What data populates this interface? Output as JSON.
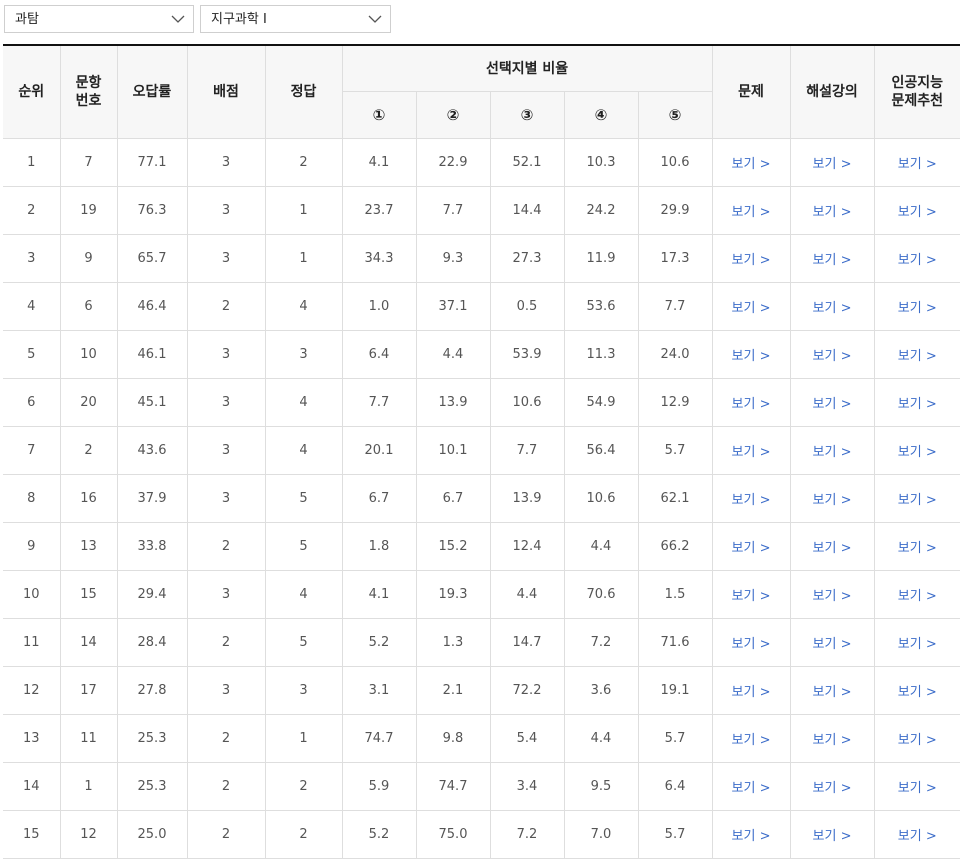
{
  "filters": {
    "category": "과탐",
    "subject": "지구과학 I"
  },
  "table": {
    "headers": {
      "rank": "순위",
      "question_no_line1": "문항",
      "question_no_line2": "번호",
      "error_rate": "오답률",
      "points": "배점",
      "answer": "정답",
      "choice_ratio": "선택지별 비율",
      "choices": [
        "①",
        "②",
        "③",
        "④",
        "⑤"
      ],
      "problem": "문제",
      "lecture": "해설강의",
      "ai_line1": "인공지능",
      "ai_line2": "문제추천"
    },
    "link_label": "보기 >",
    "rows": [
      {
        "rank": "1",
        "no": "7",
        "error": "77.1",
        "points": "3",
        "answer": "2",
        "c1": "4.1",
        "c2": "22.9",
        "c3": "52.1",
        "c4": "10.3",
        "c5": "10.6"
      },
      {
        "rank": "2",
        "no": "19",
        "error": "76.3",
        "points": "3",
        "answer": "1",
        "c1": "23.7",
        "c2": "7.7",
        "c3": "14.4",
        "c4": "24.2",
        "c5": "29.9"
      },
      {
        "rank": "3",
        "no": "9",
        "error": "65.7",
        "points": "3",
        "answer": "1",
        "c1": "34.3",
        "c2": "9.3",
        "c3": "27.3",
        "c4": "11.9",
        "c5": "17.3"
      },
      {
        "rank": "4",
        "no": "6",
        "error": "46.4",
        "points": "2",
        "answer": "4",
        "c1": "1.0",
        "c2": "37.1",
        "c3": "0.5",
        "c4": "53.6",
        "c5": "7.7"
      },
      {
        "rank": "5",
        "no": "10",
        "error": "46.1",
        "points": "3",
        "answer": "3",
        "c1": "6.4",
        "c2": "4.4",
        "c3": "53.9",
        "c4": "11.3",
        "c5": "24.0"
      },
      {
        "rank": "6",
        "no": "20",
        "error": "45.1",
        "points": "3",
        "answer": "4",
        "c1": "7.7",
        "c2": "13.9",
        "c3": "10.6",
        "c4": "54.9",
        "c5": "12.9"
      },
      {
        "rank": "7",
        "no": "2",
        "error": "43.6",
        "points": "3",
        "answer": "4",
        "c1": "20.1",
        "c2": "10.1",
        "c3": "7.7",
        "c4": "56.4",
        "c5": "5.7"
      },
      {
        "rank": "8",
        "no": "16",
        "error": "37.9",
        "points": "3",
        "answer": "5",
        "c1": "6.7",
        "c2": "6.7",
        "c3": "13.9",
        "c4": "10.6",
        "c5": "62.1"
      },
      {
        "rank": "9",
        "no": "13",
        "error": "33.8",
        "points": "2",
        "answer": "5",
        "c1": "1.8",
        "c2": "15.2",
        "c3": "12.4",
        "c4": "4.4",
        "c5": "66.2"
      },
      {
        "rank": "10",
        "no": "15",
        "error": "29.4",
        "points": "3",
        "answer": "4",
        "c1": "4.1",
        "c2": "19.3",
        "c3": "4.4",
        "c4": "70.6",
        "c5": "1.5"
      },
      {
        "rank": "11",
        "no": "14",
        "error": "28.4",
        "points": "2",
        "answer": "5",
        "c1": "5.2",
        "c2": "1.3",
        "c3": "14.7",
        "c4": "7.2",
        "c5": "71.6"
      },
      {
        "rank": "12",
        "no": "17",
        "error": "27.8",
        "points": "3",
        "answer": "3",
        "c1": "3.1",
        "c2": "2.1",
        "c3": "72.2",
        "c4": "3.6",
        "c5": "19.1"
      },
      {
        "rank": "13",
        "no": "11",
        "error": "25.3",
        "points": "2",
        "answer": "1",
        "c1": "74.7",
        "c2": "9.8",
        "c3": "5.4",
        "c4": "4.4",
        "c5": "5.7"
      },
      {
        "rank": "14",
        "no": "1",
        "error": "25.3",
        "points": "2",
        "answer": "2",
        "c1": "5.9",
        "c2": "74.7",
        "c3": "3.4",
        "c4": "9.5",
        "c5": "6.4"
      },
      {
        "rank": "15",
        "no": "12",
        "error": "25.0",
        "points": "2",
        "answer": "2",
        "c1": "5.2",
        "c2": "75.0",
        "c3": "7.2",
        "c4": "7.0",
        "c5": "5.7"
      }
    ]
  },
  "colors": {
    "link": "#3b6cc9",
    "header_bg": "#f7f7f7",
    "border": "#dedede",
    "top_rule": "#111111"
  },
  "icons": {
    "dropdown": "chevron-down-icon"
  }
}
